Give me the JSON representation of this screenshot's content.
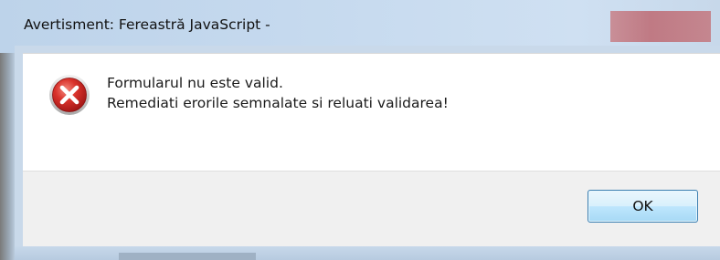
{
  "dialog": {
    "title": "Avertisment: Fereastră JavaScript -",
    "message_line1": "Formularul nu este valid.",
    "message_line2": "Remediati erorile semnalate si reluati validarea!",
    "ok_label": "OK",
    "icon": "error-icon"
  },
  "colors": {
    "titlebar": "#c5d9ee",
    "error_red": "#d02b2b",
    "button_border": "#3c7fb1"
  }
}
